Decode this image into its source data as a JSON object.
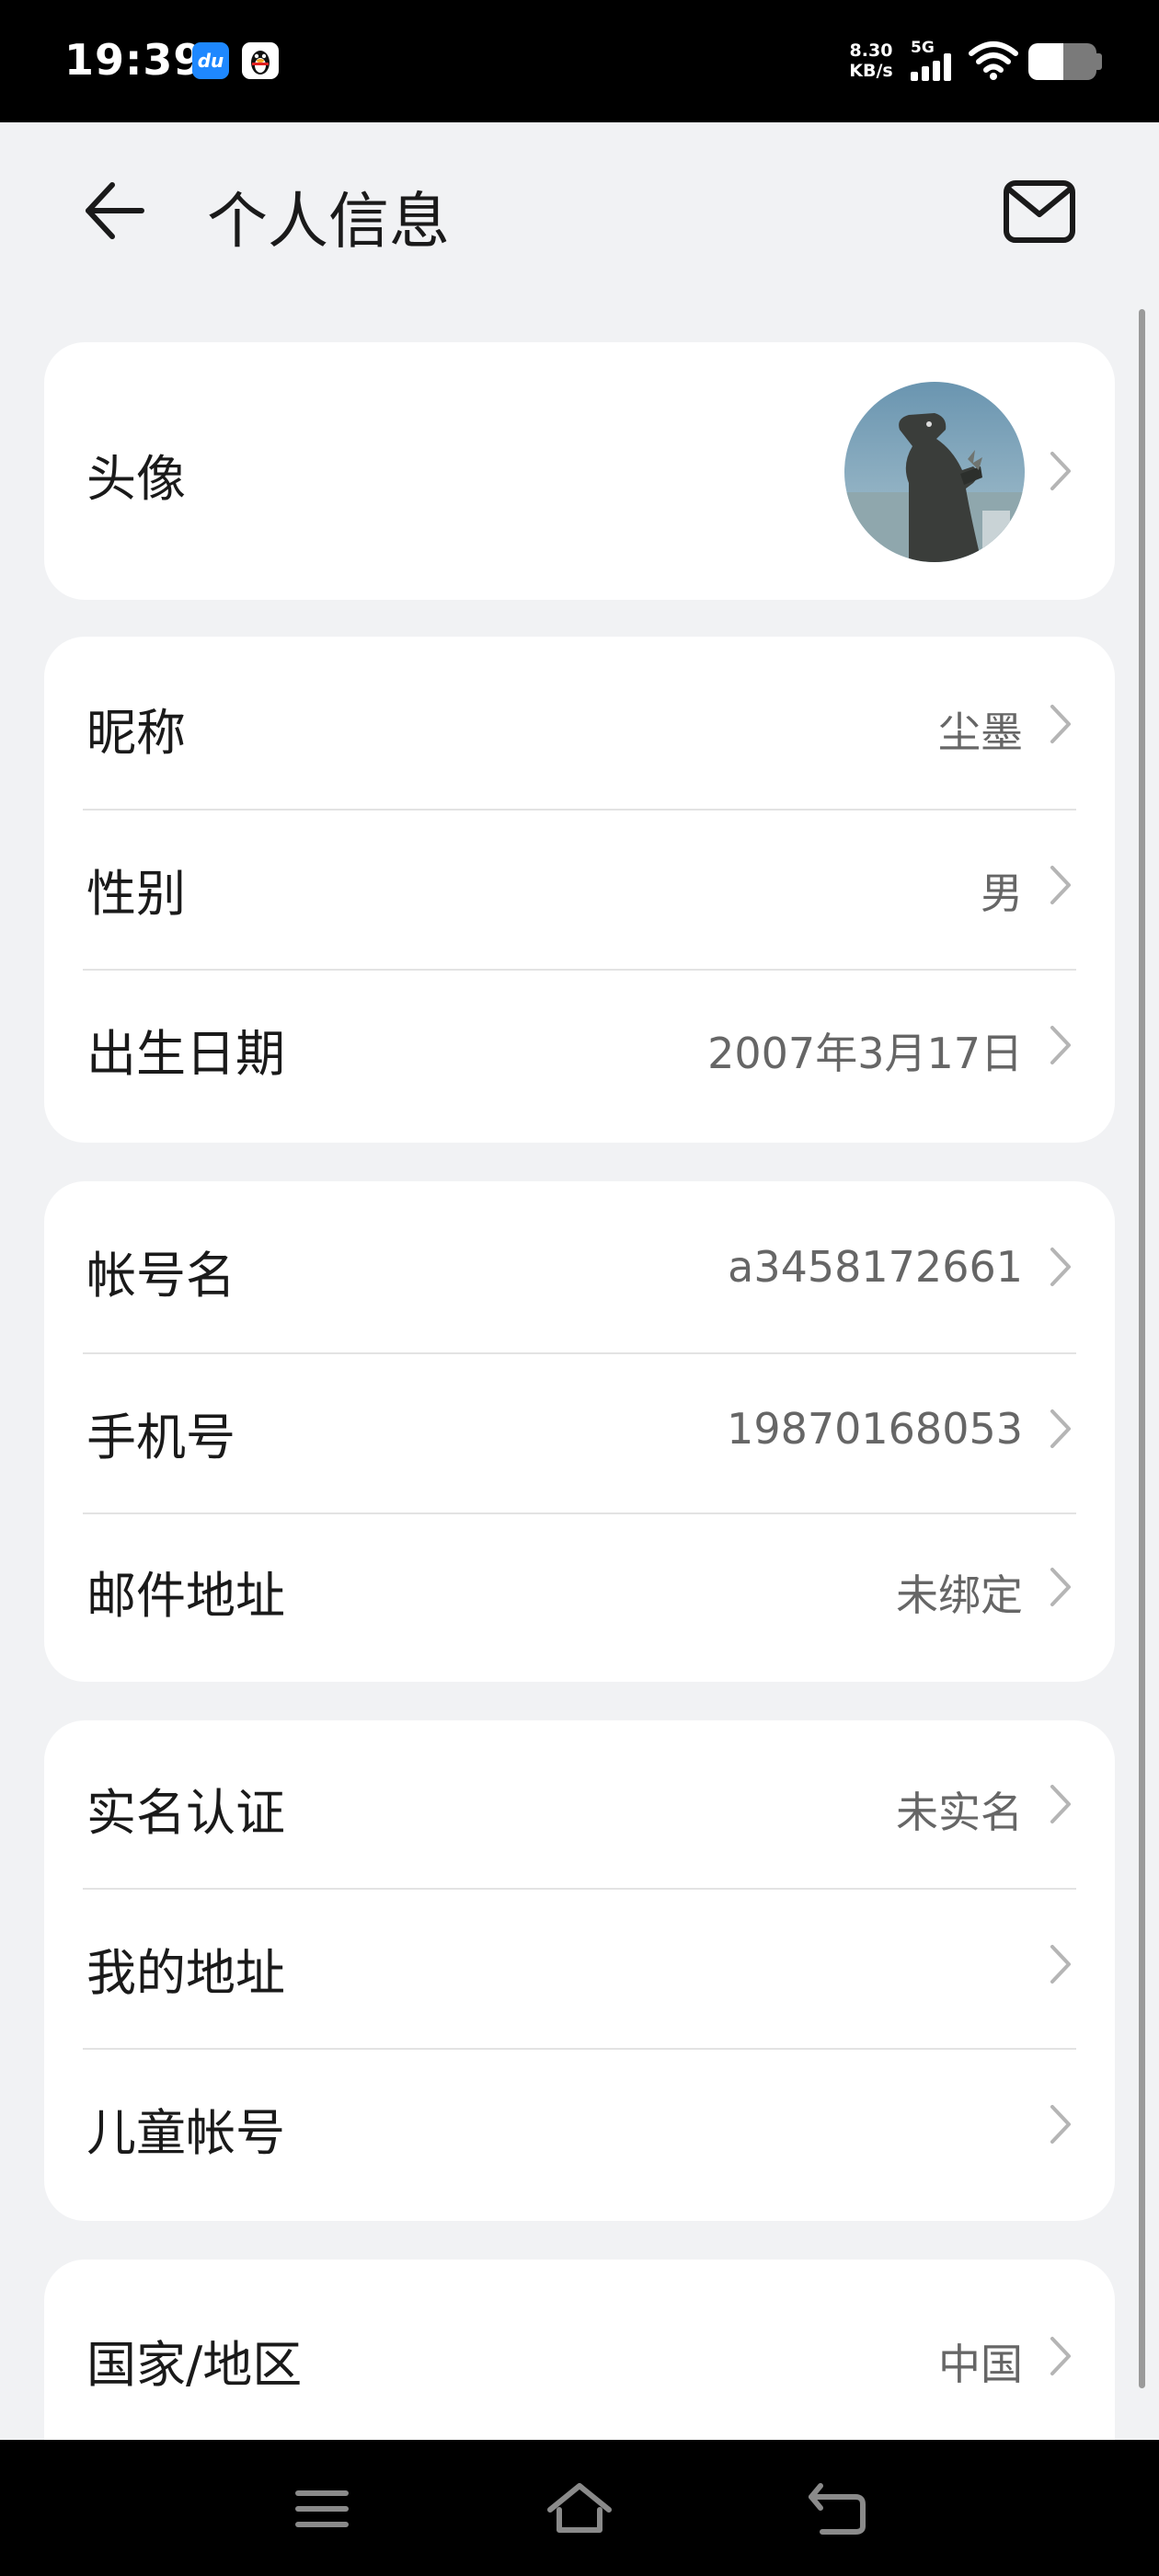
{
  "status_bar": {
    "time": "19:39",
    "net_speed_value": "8.30",
    "net_speed_unit": "KB/s",
    "network_type": "5G",
    "notification_icons": [
      "baidu-du-icon",
      "qq-penguin-icon"
    ]
  },
  "header": {
    "title": "个人信息",
    "back_icon": "arrow-left-icon",
    "mail_icon": "mail-icon"
  },
  "avatar_section": {
    "label": "头像"
  },
  "profile_section": {
    "items": [
      {
        "label": "昵称",
        "value": "尘墨"
      },
      {
        "label": "性别",
        "value": "男"
      },
      {
        "label": "出生日期",
        "value": "2007年3月17日"
      }
    ]
  },
  "account_section": {
    "items": [
      {
        "label": "帐号名",
        "value": "a3458172661"
      },
      {
        "label": "手机号",
        "value": "19870168053"
      },
      {
        "label": "邮件地址",
        "value": "未绑定"
      }
    ]
  },
  "security_section": {
    "items": [
      {
        "label": "实名认证",
        "value": "未实名"
      },
      {
        "label": "我的地址",
        "value": ""
      },
      {
        "label": "儿童帐号",
        "value": ""
      }
    ]
  },
  "region_section": {
    "items": [
      {
        "label": "国家/地区",
        "value": "中国"
      }
    ]
  },
  "nav_bar": {
    "icons": [
      "menu-icon",
      "home-icon",
      "back-icon"
    ]
  },
  "colors": {
    "background": "#f1f2f4",
    "card": "#ffffff",
    "primary_text": "#1a1a1a",
    "secondary_text": "#666666",
    "chevron": "#b5b5b5"
  }
}
